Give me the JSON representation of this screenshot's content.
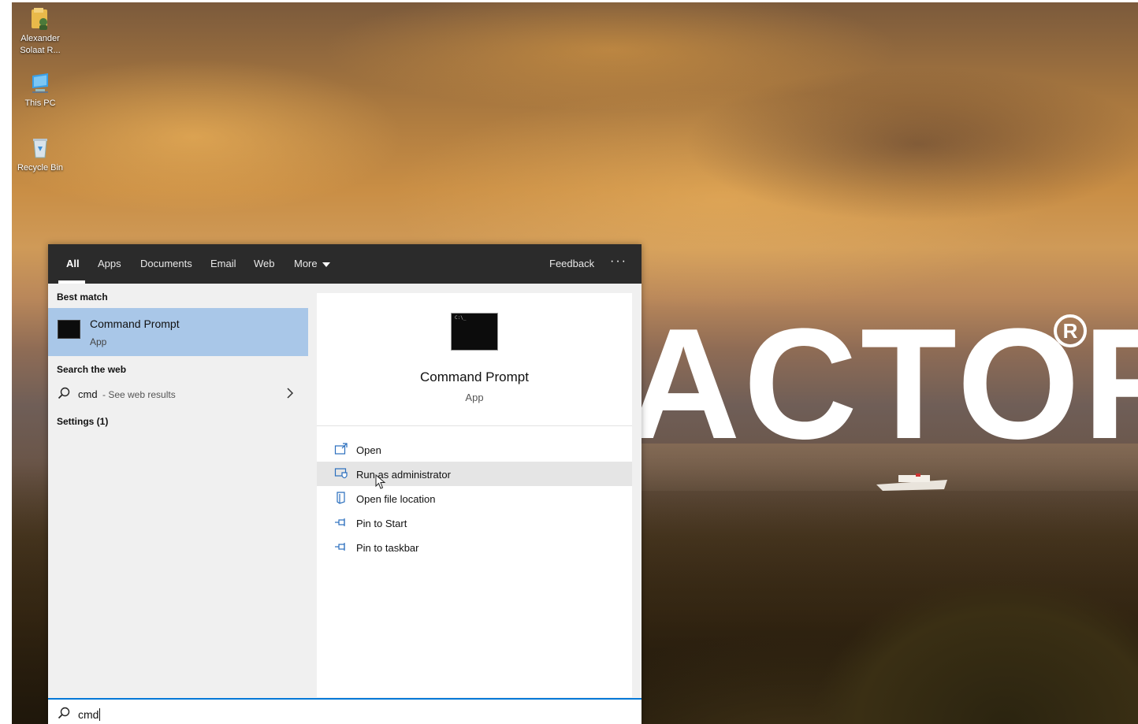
{
  "desktop": {
    "icons": [
      {
        "label": "Alexander\nSolaat R..."
      },
      {
        "label": "This PC"
      },
      {
        "label": "Recycle Bin"
      }
    ],
    "wallpaper_brand_text": "ACTOR",
    "wallpaper_brand_mark": "R"
  },
  "search": {
    "tabs": [
      {
        "label": "All",
        "active": true
      },
      {
        "label": "Apps"
      },
      {
        "label": "Documents"
      },
      {
        "label": "Email"
      },
      {
        "label": "Web"
      },
      {
        "label": "More"
      }
    ],
    "feedback_label": "Feedback",
    "more_options_label": "···",
    "best_match_heading": "Best match",
    "best_match": {
      "title": "Command Prompt",
      "subtitle": "App",
      "icon": "cmd-icon"
    },
    "web_heading": "Search the web",
    "web_result": {
      "query": "cmd",
      "hint": " - See web results"
    },
    "settings_heading": "Settings (1)",
    "preview": {
      "title": "Command Prompt",
      "subtitle": "App",
      "actions": [
        {
          "label": "Open",
          "icon": "open-icon"
        },
        {
          "label": "Run as administrator",
          "icon": "shield-icon",
          "hovered": true
        },
        {
          "label": "Open file location",
          "icon": "folder-icon"
        },
        {
          "label": "Pin to Start",
          "icon": "pin-icon"
        },
        {
          "label": "Pin to taskbar",
          "icon": "pin-icon"
        }
      ]
    },
    "query_value": "cmd"
  },
  "colors": {
    "tab_bar": "#2b2b2b",
    "best_match_highlight": "#a9c7e8",
    "search_focus_border": "#0078d7",
    "action_icon": "#2a6ebd"
  }
}
